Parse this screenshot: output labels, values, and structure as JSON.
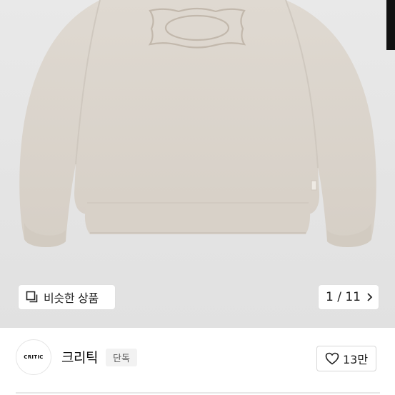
{
  "product_image": {
    "alt": ""
  },
  "gallery": {
    "similar_label": "비슷한 상품",
    "pager": "1 / 11"
  },
  "shop": {
    "logo_text": "CRITIC",
    "name": "크리틱",
    "badge": "단독"
  },
  "like": {
    "count": "13만"
  },
  "icons": {
    "similar": "squares-icon",
    "next": "chevron-right-icon",
    "like": "heart-icon"
  },
  "colors": {
    "background": "#e6e6e6",
    "sweatshirt": "#ddd6cd",
    "text": "#222222"
  }
}
